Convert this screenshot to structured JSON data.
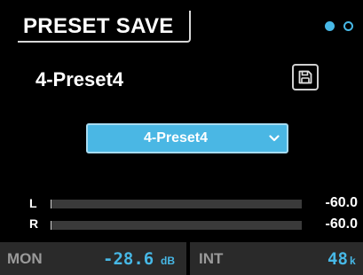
{
  "header": {
    "title": "PRESET SAVE"
  },
  "page_indicator": {
    "total": 2,
    "active": 1
  },
  "preset": {
    "name": "4-Preset4"
  },
  "save_button": {
    "icon": "floppy-disk-icon"
  },
  "dropdown": {
    "selected": "4-Preset4",
    "icon": "chevron-down-icon"
  },
  "meters": [
    {
      "label": "L",
      "value": "-60.0",
      "level": 0.0
    },
    {
      "label": "R",
      "value": "-60.0",
      "level": 0.0
    }
  ],
  "footer": {
    "monitor": {
      "label": "MON",
      "value": "-28.6",
      "unit": "dB"
    },
    "clock": {
      "label": "INT",
      "value": "48",
      "unit": "k"
    }
  },
  "colors": {
    "accent": "#47b8e6",
    "background": "#000000",
    "footer_bg": "#2a2a2a",
    "meter_track": "#3a3a3a",
    "dropdown_bg": "#4ab7e4"
  }
}
